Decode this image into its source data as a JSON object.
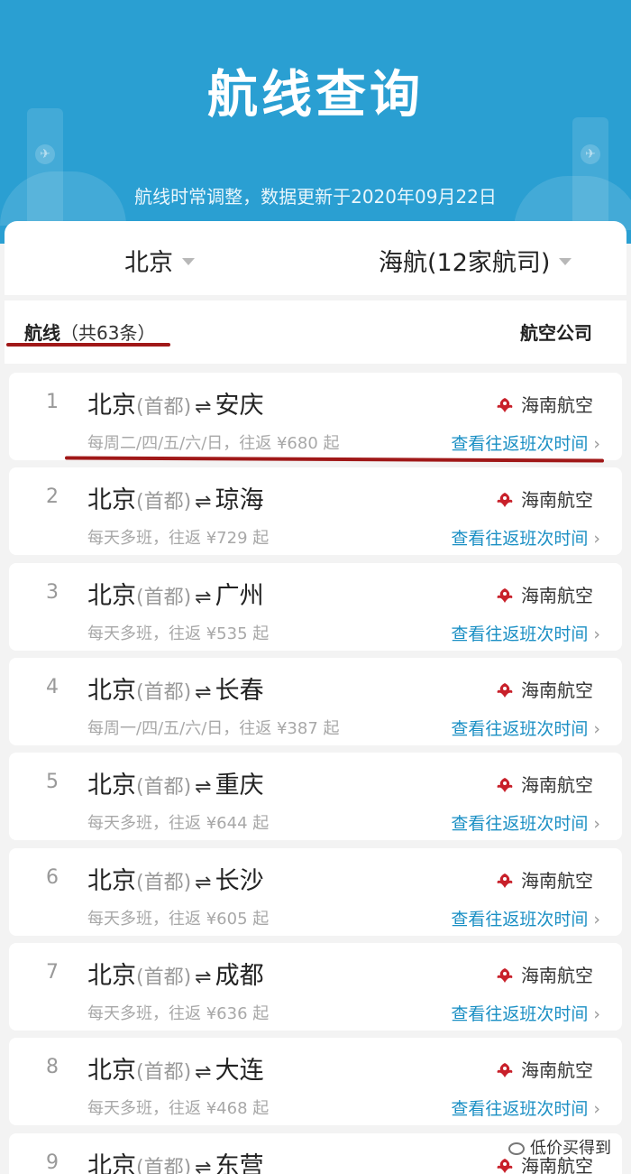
{
  "header": {
    "title": "航线查询",
    "subtitle": "航线时常调整，数据更新于2020年09月22日"
  },
  "filters": {
    "city": "北京",
    "airline": "海航(12家航司)"
  },
  "tabs": {
    "left_label": "航线",
    "left_count": "（共63条）",
    "right_label": "航空公司"
  },
  "colors": {
    "brand_blue": "#2a9fd2",
    "link_blue": "#1a8fc4",
    "annotation_red": "#a01818"
  },
  "routes": [
    {
      "index": "1",
      "origin": "北京",
      "origin_airport": "(首都)",
      "arrows": "⇌",
      "destination": "安庆",
      "schedule": "每周二/四/五/六/日，往返 ¥680 起",
      "airline": "海南航空",
      "link": "查看往返班次时间",
      "chevron": "›"
    },
    {
      "index": "2",
      "origin": "北京",
      "origin_airport": "(首都)",
      "arrows": "⇌",
      "destination": "琼海",
      "schedule": "每天多班，往返 ¥729 起",
      "airline": "海南航空",
      "link": "查看往返班次时间",
      "chevron": "›"
    },
    {
      "index": "3",
      "origin": "北京",
      "origin_airport": "(首都)",
      "arrows": "⇌",
      "destination": "广州",
      "schedule": "每天多班，往返 ¥535 起",
      "airline": "海南航空",
      "link": "查看往返班次时间",
      "chevron": "›"
    },
    {
      "index": "4",
      "origin": "北京",
      "origin_airport": "(首都)",
      "arrows": "⇌",
      "destination": "长春",
      "schedule": "每周一/四/五/六/日，往返 ¥387 起",
      "airline": "海南航空",
      "link": "查看往返班次时间",
      "chevron": "›"
    },
    {
      "index": "5",
      "origin": "北京",
      "origin_airport": "(首都)",
      "arrows": "⇌",
      "destination": "重庆",
      "schedule": "每天多班，往返 ¥644 起",
      "airline": "海南航空",
      "link": "查看往返班次时间",
      "chevron": "›"
    },
    {
      "index": "6",
      "origin": "北京",
      "origin_airport": "(首都)",
      "arrows": "⇌",
      "destination": "长沙",
      "schedule": "每天多班，往返 ¥605 起",
      "airline": "海南航空",
      "link": "查看往返班次时间",
      "chevron": "›"
    },
    {
      "index": "7",
      "origin": "北京",
      "origin_airport": "(首都)",
      "arrows": "⇌",
      "destination": "成都",
      "schedule": "每天多班，往返 ¥636 起",
      "airline": "海南航空",
      "link": "查看往返班次时间",
      "chevron": "›"
    },
    {
      "index": "8",
      "origin": "北京",
      "origin_airport": "(首都)",
      "arrows": "⇌",
      "destination": "大连",
      "schedule": "每天多班，往返 ¥468 起",
      "airline": "海南航空",
      "link": "查看往返班次时间",
      "chevron": "›"
    },
    {
      "index": "9",
      "origin": "北京",
      "origin_airport": "(首都)",
      "arrows": "⇌",
      "destination": "东营",
      "schedule": "",
      "airline": "海南航空",
      "link": "",
      "chevron": ""
    }
  ],
  "watermark": "低价买得到"
}
